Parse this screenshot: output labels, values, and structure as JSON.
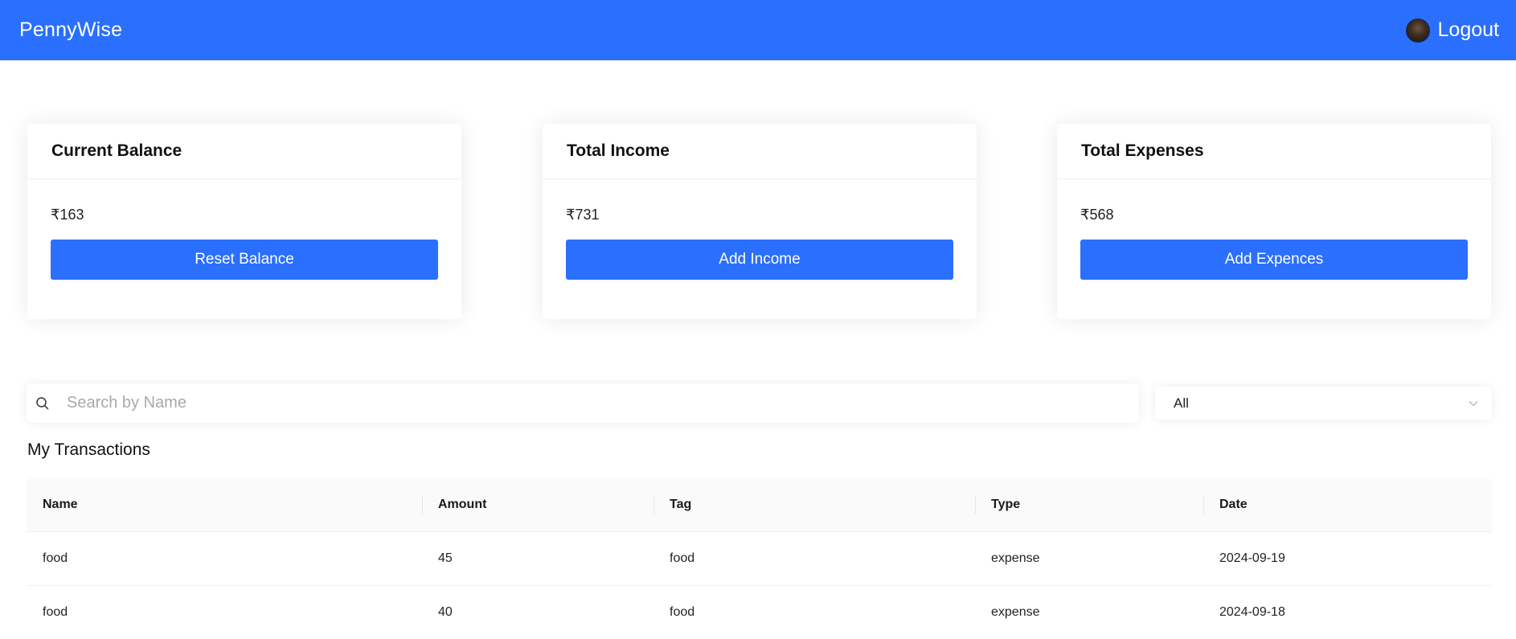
{
  "navbar": {
    "brand": "PennyWise",
    "logout_label": "Logout"
  },
  "cards": [
    {
      "title": "Current Balance",
      "value": "₹163",
      "button": "Reset Balance"
    },
    {
      "title": "Total Income",
      "value": "₹731",
      "button": "Add Income"
    },
    {
      "title": "Total Expenses",
      "value": "₹568",
      "button": "Add Expences"
    }
  ],
  "search": {
    "placeholder": "Search by Name",
    "value": ""
  },
  "filter": {
    "selected": "All"
  },
  "transactions": {
    "title": "My Transactions",
    "columns": [
      "Name",
      "Amount",
      "Tag",
      "Type",
      "Date"
    ],
    "rows": [
      [
        "food",
        "45",
        "food",
        "expense",
        "2024-09-19"
      ],
      [
        "food",
        "40",
        "food",
        "expense",
        "2024-09-18"
      ]
    ]
  },
  "colors": {
    "accent": "#2a6ffd",
    "background": "#ffffff",
    "table_header_bg": "#fafafa"
  },
  "icons": {
    "search": "search-icon",
    "dropdown": "chevron-down-icon",
    "avatar": "user-avatar"
  }
}
